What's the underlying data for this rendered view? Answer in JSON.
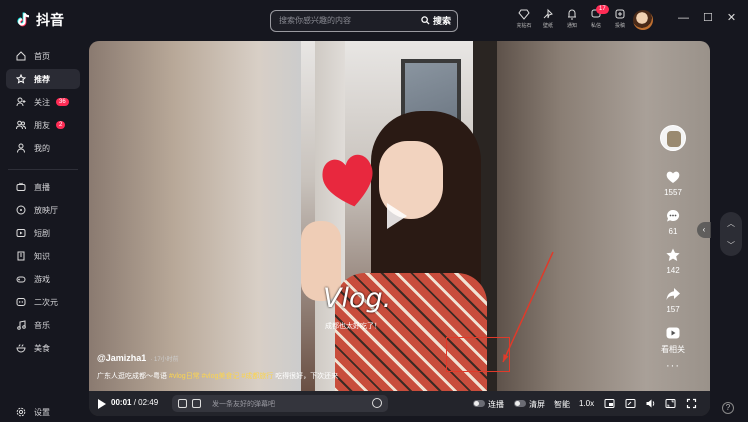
{
  "app": {
    "name": "抖音"
  },
  "search": {
    "placeholder": "搜索你感兴趣的内容",
    "button": "搜索"
  },
  "topbar": {
    "items": [
      {
        "label": "充钻石",
        "icon": "diamond-icon"
      },
      {
        "label": "壁纸",
        "icon": "wallpaper-icon"
      },
      {
        "label": "通知",
        "icon": "bell-icon"
      },
      {
        "label": "私信",
        "icon": "message-icon",
        "badge": "17"
      },
      {
        "label": "投稿",
        "icon": "upload-icon"
      }
    ]
  },
  "sidebar": {
    "items": [
      {
        "label": "首页",
        "icon": "home-icon"
      },
      {
        "label": "推荐",
        "icon": "recommend-icon",
        "active": true
      },
      {
        "label": "关注",
        "icon": "follow-icon",
        "count": "36"
      },
      {
        "label": "朋友",
        "icon": "friends-icon",
        "count": "2"
      },
      {
        "label": "我的",
        "icon": "profile-icon"
      },
      {
        "label": "直播",
        "icon": "live-icon"
      },
      {
        "label": "放映厅",
        "icon": "cinema-icon"
      },
      {
        "label": "短剧",
        "icon": "drama-icon"
      },
      {
        "label": "知识",
        "icon": "knowledge-icon"
      },
      {
        "label": "游戏",
        "icon": "game-icon"
      },
      {
        "label": "二次元",
        "icon": "anime-icon"
      },
      {
        "label": "音乐",
        "icon": "music-icon"
      },
      {
        "label": "美食",
        "icon": "food-icon"
      }
    ],
    "settings": "设置"
  },
  "video": {
    "overlay_text": "Vlog.",
    "overlay_sub": "成都也太好吃了！",
    "author": "@Jamizha1",
    "posted": "· 17小时前",
    "desc_prefix": "广东人逛吃成都～粤语",
    "tags": [
      "#vlog日常",
      "#vlog美食记",
      "#成都旅行"
    ],
    "desc_suffix": "吃得很好，下次还来"
  },
  "actions": {
    "likes": "1557",
    "comments": "61",
    "favorites": "142",
    "shares": "157",
    "related": "看相关",
    "more": "···"
  },
  "controls": {
    "current_time": "00:01",
    "separator": " / ",
    "duration": "02:49",
    "danmu_placeholder": "发一条友好的弹幕吧",
    "autoplay": "连播",
    "clear": "清屏",
    "smart": "智能",
    "speed": "1.0x"
  },
  "colors": {
    "accent": "#fe2c55",
    "tag": "#fbd44e",
    "highlight_box": "#e03a2a"
  }
}
